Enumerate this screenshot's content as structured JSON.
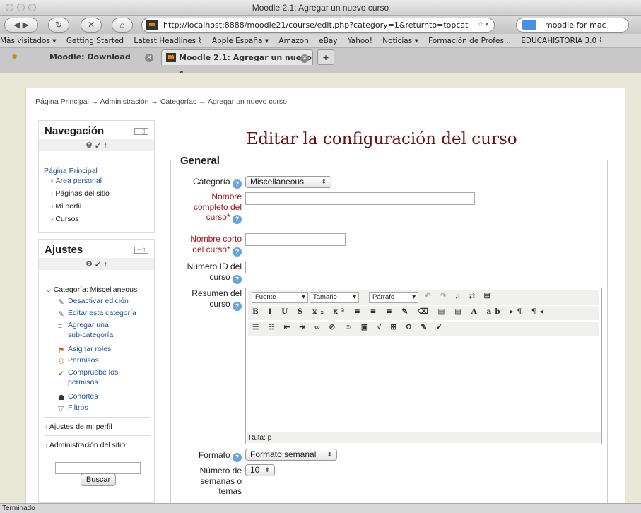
{
  "window": {
    "title": "Moodle 2.1: Agregar un nuevo curso"
  },
  "toolbar": {
    "url": "http://localhost:8888/moodle21/course/edit.php?category=1&returnto=topcat",
    "search_value": "moodle for mac"
  },
  "bookmarks": [
    "Más visitados ▾",
    "Getting Started",
    "Latest Headlines ⌇",
    "Apple España ▾",
    "Amazon",
    "eBay",
    "Yahoo!",
    "Noticias ▾",
    "Formación de Profes...",
    "EDUCAHISTORIA 3.0 ⌇"
  ],
  "tabs": [
    {
      "label": "Moodle: Download"
    },
    {
      "label": "Moodle 2.1: Agregar un nuevo c..."
    }
  ],
  "breadcrumb": "Página Principal → Administración → Categorías → Agregar un nuevo curso",
  "navigation": {
    "title": "Navegación",
    "home": "Página Principal",
    "items": [
      "Área personal",
      "Páginas del sitio",
      "Mi perfil",
      "Cursos"
    ]
  },
  "settings": {
    "title": "Ajustes",
    "category": "Categoría: Miscellaneous",
    "items": [
      "Desactivar edición",
      "Editar esta categoría",
      "Agregar una",
      "sub-categoría",
      "Asignar roles",
      "Permisos",
      "Compruebe los",
      "permisos",
      "Cohortes",
      "Filtros"
    ],
    "profile": "Ajustes de mi perfil",
    "admin": "Administración del sitio",
    "search_button": "Buscar"
  },
  "page_title": "Editar la configuración del curso",
  "form": {
    "legend": "General",
    "category_label": "Categoría",
    "category_value": "Miscellaneous",
    "fullname_label": [
      "Nombre",
      "completo del",
      "curso*"
    ],
    "shortname_label": [
      "Nombre corto",
      "del curso*"
    ],
    "idnumber_label": [
      "Número ID del",
      "curso"
    ],
    "summary_label": [
      "Resumen del",
      "curso"
    ],
    "editor": {
      "font": "Fuente",
      "size": "Tamaño",
      "paragraph": "Párrafo",
      "path": "Ruta: p"
    },
    "format_label": "Formato",
    "format_value": "Formato semanal",
    "weeks_label": [
      "Número de",
      "semanas o",
      "temas"
    ],
    "weeks_value": "10"
  },
  "status": "Terminado"
}
